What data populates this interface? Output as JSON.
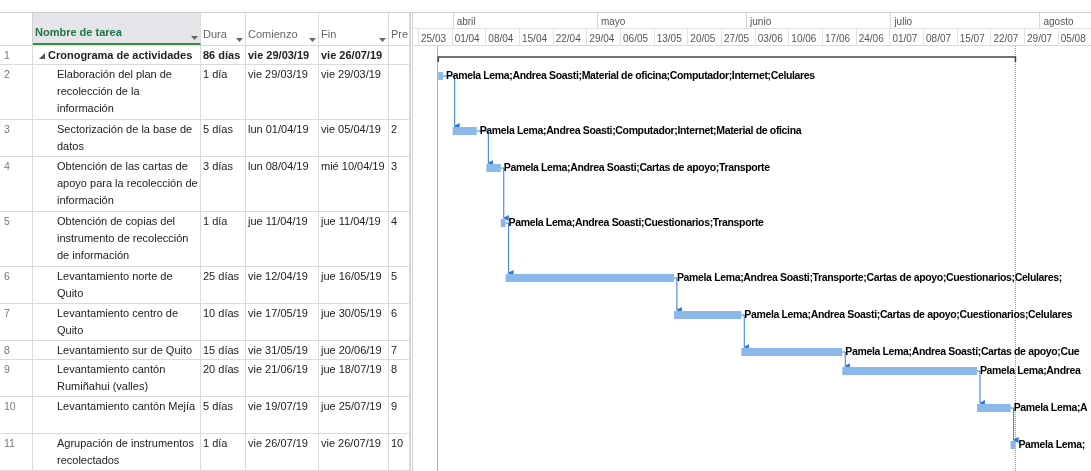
{
  "columns": [
    {
      "label": "Nombre de tarea",
      "selected": true,
      "dropdown": true
    },
    {
      "label": "Dura",
      "selected": false,
      "dropdown": true
    },
    {
      "label": "Comienzo",
      "selected": false,
      "dropdown": true
    },
    {
      "label": "Fin",
      "selected": false,
      "dropdown": true
    },
    {
      "label": "Pre",
      "selected": false,
      "dropdown": false
    }
  ],
  "timescale": {
    "months": [
      "abril",
      "mayo",
      "junio",
      "julio",
      "agosto"
    ],
    "weeks": [
      "25/03",
      "01/04",
      "08/04",
      "15/04",
      "22/04",
      "29/04",
      "06/05",
      "13/05",
      "20/05",
      "27/05",
      "03/06",
      "10/06",
      "17/06",
      "24/06",
      "01/07",
      "08/07",
      "15/07",
      "22/07",
      "29/07",
      "05/08"
    ]
  },
  "tasks": [
    {
      "id": "1",
      "name": "Cronograma de actividades",
      "duration": "86 días",
      "start": "vie 29/03/19",
      "finish": "vie 26/07/19",
      "kind": "summary",
      "expanded": true,
      "children": [
        {
          "id": "2",
          "name": "Elaboración del plan de recolección de la información",
          "duration": "1 día",
          "start": "vie 29/03/19",
          "finish": "vie 29/03/19",
          "kind": "task",
          "resources": "Pamela Lema;Andrea Soasti;Material de oficina;Computador;Internet;Celulares"
        },
        {
          "id": "3",
          "name": "Sectorización de la base de datos",
          "duration": "5 días",
          "start": "lun 01/04/19",
          "finish": "vie 05/04/19",
          "predecessor": "2",
          "kind": "task",
          "resources": "Pamela Lema;Andrea Soasti;Computador;Internet;Material de oficina"
        },
        {
          "id": "4",
          "name": "Obtención de las cartas de apoyo para la recolección de información",
          "duration": "3 días",
          "start": "lun 08/04/19",
          "finish": "mié 10/04/19",
          "predecessor": "3",
          "kind": "task",
          "resources": "Pamela Lema;Andrea Soasti;Cartas de apoyo;Transporte"
        },
        {
          "id": "5",
          "name": "Obtención de copias del instrumento de recolección de información",
          "duration": "1 día",
          "start": "jue 11/04/19",
          "finish": "jue 11/04/19",
          "predecessor": "4",
          "kind": "task",
          "resources": "Pamela Lema;Andrea Soasti;Cuestionarios;Transporte"
        },
        {
          "id": "6",
          "name": "Levantamiento norte de Quito",
          "duration": "25 días",
          "start": "vie 12/04/19",
          "finish": "jue 16/05/19",
          "predecessor": "5",
          "kind": "task",
          "resources": "Pamela Lema;Andrea Soasti;Transporte;Cartas de apoyo;Cuestionarios;Celulares;"
        },
        {
          "id": "7",
          "name": "Levantamiento centro de Quito",
          "duration": "10 días",
          "start": "vie 17/05/19",
          "finish": "jue 30/05/19",
          "predecessor": "6",
          "kind": "task",
          "resources": "Pamela Lema;Andrea Soasti;Cartas de apoyo;Cuestionarios;Celulares"
        },
        {
          "id": "8",
          "name": "Levantamiento sur de Quito",
          "duration": "15 días",
          "start": "vie 31/05/19",
          "finish": "jue 20/06/19",
          "predecessor": "7",
          "kind": "task",
          "resources": "Pamela Lema;Andrea Soasti;Cartas de apoyo;Cue"
        },
        {
          "id": "9",
          "name": "Levantamiento cantón Rumiñahui (valles)",
          "duration": "20 días",
          "start": "vie 21/06/19",
          "finish": "jue 18/07/19",
          "predecessor": "8",
          "kind": "task",
          "resources": "Pamela Lema;Andrea"
        },
        {
          "id": "10",
          "name": "Levantamiento cantón Mejía",
          "duration": "5 días",
          "start": "vie 19/07/19",
          "finish": "jue 25/07/19",
          "predecessor": "9",
          "kind": "task",
          "resources": "Pamela Lema;A"
        },
        {
          "id": "11",
          "name": "Agrupación de instrumentos recolectados",
          "duration": "1 día",
          "start": "vie 26/07/19",
          "finish": "vie 26/07/19",
          "predecessor": "10",
          "kind": "task",
          "resources": "Pamela Lema;"
        }
      ]
    }
  ]
}
